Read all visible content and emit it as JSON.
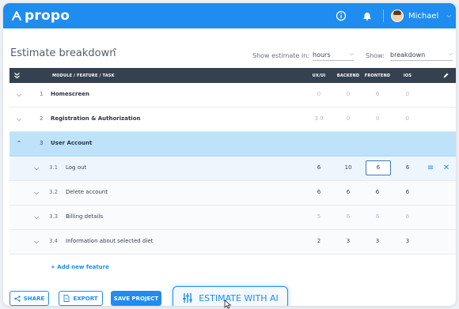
{
  "app": {
    "brand": "propo"
  },
  "topbar": {
    "user_name": "Michael"
  },
  "section": {
    "title": "Estimate breakdown"
  },
  "controls": {
    "show_estimate_label": "Show estimate in:",
    "unit_value": "hours",
    "show_label": "Show:",
    "show_value": "breakdown"
  },
  "table": {
    "headers": {
      "module": "MODULE / FEATURE / TASK",
      "uxui": "UX/UI",
      "backend": "BACKEND",
      "frontend": "FRONTEND",
      "ios": "IOS"
    },
    "rows": [
      {
        "num": "1",
        "name": "Homescreen",
        "uxui": "0",
        "backend": "0",
        "frontend": "0",
        "ios": "0"
      },
      {
        "num": "2",
        "name": "Registration & Authorization",
        "uxui": "3.9",
        "backend": "0",
        "frontend": "0",
        "ios": "0"
      },
      {
        "num": "3",
        "name": "User Account"
      },
      {
        "num": "3.1",
        "name": "Log out",
        "uxui": "6",
        "backend": "10",
        "frontend": "6",
        "ios": "6"
      },
      {
        "num": "3.2",
        "name": "Delete account",
        "uxui": "6",
        "backend": "6",
        "frontend": "6",
        "ios": "6"
      },
      {
        "num": "3.3",
        "name": "Billing details",
        "uxui": "5",
        "backend": "6",
        "frontend": "6",
        "ios": "6"
      },
      {
        "num": "3.4",
        "name": "Information about selected diet",
        "uxui": "2",
        "backend": "3",
        "frontend": "3",
        "ios": "3"
      }
    ],
    "add_feature": "+ Add new feature"
  },
  "footer": {
    "share": "SHARE",
    "export": "EXPORT",
    "save": "SAVE PROJECT",
    "estimate_ai": "ESTIMATE WITH AI"
  },
  "colors": {
    "primary": "#1f8cf0",
    "header_dark": "#364150",
    "active_row": "#bee2fa"
  }
}
